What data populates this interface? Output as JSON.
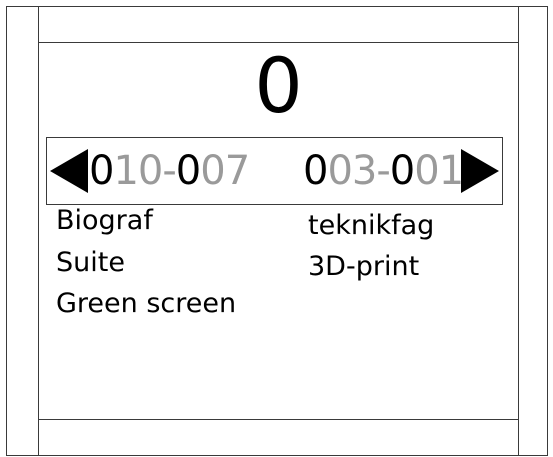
{
  "counter": "0",
  "navigator": {
    "left_code": [
      {
        "text": "0",
        "tone": "dark"
      },
      {
        "text": "10-",
        "tone": "grey"
      },
      {
        "text": "0",
        "tone": "dark"
      },
      {
        "text": "07",
        "tone": "grey"
      }
    ],
    "right_code": [
      {
        "text": "0",
        "tone": "dark"
      },
      {
        "text": "03-",
        "tone": "grey"
      },
      {
        "text": "0",
        "tone": "dark"
      },
      {
        "text": "01",
        "tone": "grey"
      }
    ],
    "left_icon": "triangle-left-icon",
    "right_icon": "triangle-right-icon"
  },
  "left_list": [
    "Biograf",
    "Suite",
    "Green screen"
  ],
  "right_list": [
    "teknikfag",
    "3D-print"
  ],
  "colors": {
    "text": "#000000",
    "muted_digits": "#9a9a9a",
    "border": "#3a3a3a",
    "background": "#ffffff"
  }
}
